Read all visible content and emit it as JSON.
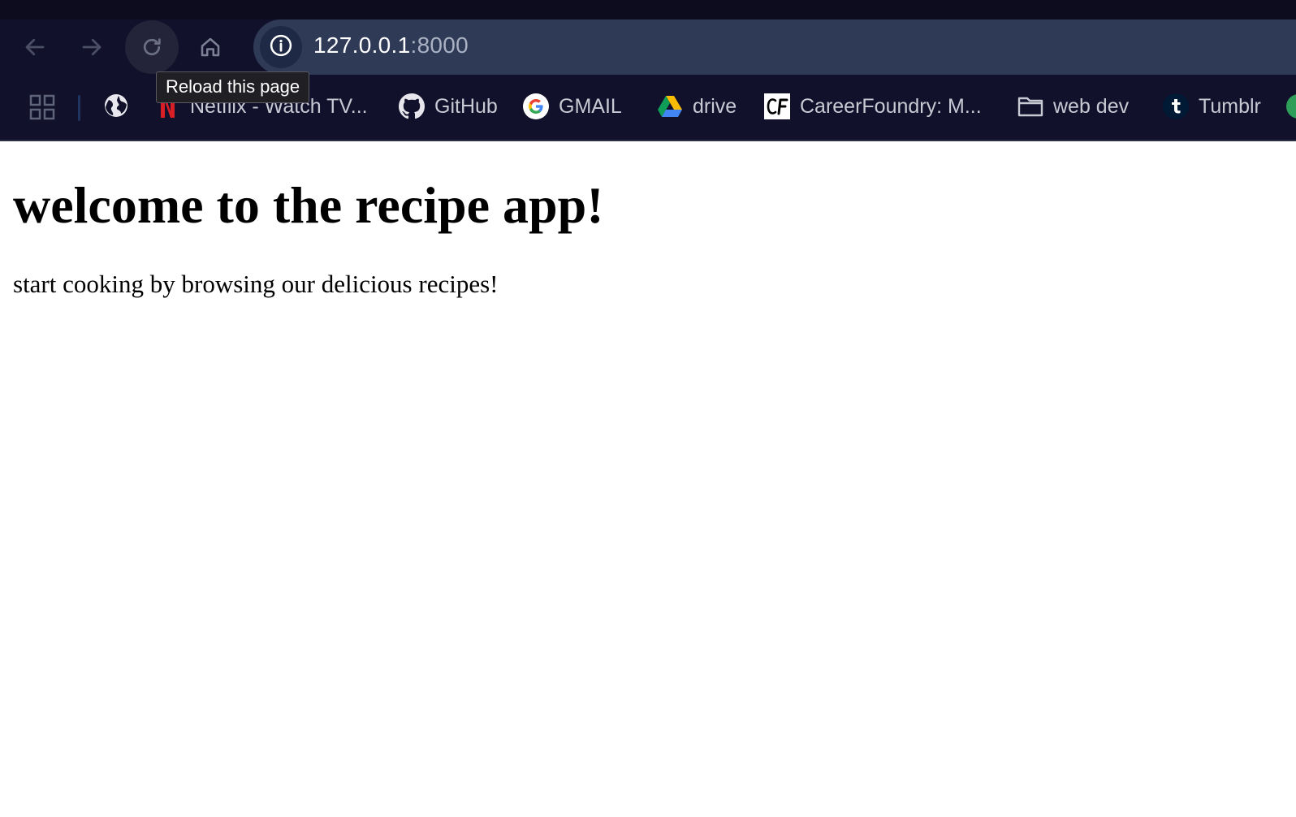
{
  "browser": {
    "address_bar": {
      "host": "127.0.0.1",
      "port": ":8000"
    },
    "tooltip": "Reload this page",
    "bookmarks": [
      {
        "label": "Netflix - Watch TV...",
        "icon": "netflix-icon"
      },
      {
        "label": "GitHub",
        "icon": "github-icon"
      },
      {
        "label": "GMAIL",
        "icon": "google-icon"
      },
      {
        "label": "drive",
        "icon": "google-drive-icon"
      },
      {
        "label": "CareerFoundry: M...",
        "icon": "careerfoundry-icon"
      },
      {
        "label": "web dev",
        "icon": "folder-icon"
      },
      {
        "label": "Tumblr",
        "icon": "tumblr-icon"
      }
    ],
    "colors": {
      "chrome_background": "#11112b",
      "omnibox_background": "#2f3a57",
      "bookmark_text": "#c7c9d3"
    }
  },
  "page": {
    "title": "welcome to the recipe app!",
    "subtitle": "start cooking by browsing our delicious recipes!"
  }
}
